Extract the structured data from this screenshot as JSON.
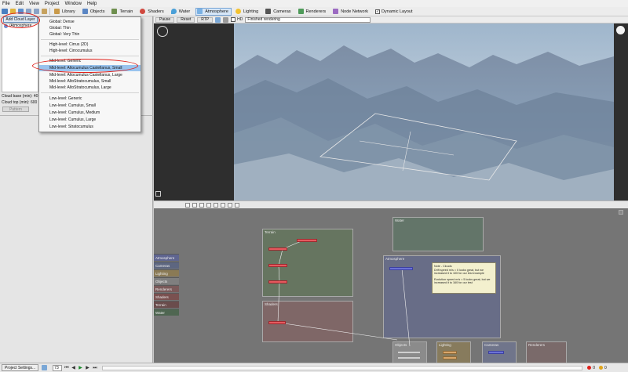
{
  "menubar": {
    "file": "File",
    "edit": "Edit",
    "view": "View",
    "project": "Project",
    "window": "Window",
    "help": "Help"
  },
  "toolbar": {
    "library": "Library",
    "objects": "Objects",
    "terrain": "Terrain",
    "shaders": "Shaders",
    "water": "Water",
    "atmosphere": "Atmosphere",
    "lighting": "Lighting",
    "cameras": "Cameras",
    "renderers": "Renderers",
    "node_network": "Node Network",
    "dynamic_layout": "Dynamic Layout"
  },
  "left_panel": {
    "add_cloud_layer": "Add Cloud Layer",
    "layer_item": "/Atmosphere",
    "cloud_base": "Cloud base (min): 40",
    "cloud_top": "Cloud top (min): 600",
    "pattern_button": "Pattern"
  },
  "dropdown": {
    "items": [
      "Global: Dense",
      "Global: Thin",
      "Global: Very Thin",
      "High-level: Cirrus (2D)",
      "High-level: Cirrocumulus",
      "Mid-level: Generic",
      "Mid-level: Altocumulus Castellanus, Small",
      "Mid-level: Altocumulus Castellanus, Large",
      "Mid-level: AltoStratocumulus, Small",
      "Mid-level: AltoStratocumulus, Large",
      "Low-level: Generic",
      "Low-level: Cumulus, Small",
      "Low-level: Cumulus, Medium",
      "Low-level: Cumulus, Large",
      "Low-level: Stratocumulus"
    ],
    "selected": "Mid-level: Altocumulus Castellanus, Small"
  },
  "viewport": {
    "pause": "Pause",
    "reset": "Reset",
    "rtp": "RTP",
    "hd": "HD",
    "status": "Finished rendering"
  },
  "node_editor": {
    "groups": {
      "terrain": "Terrain",
      "water": "Water",
      "atmosphere": "Atmosphere",
      "shaders": "Shaders",
      "objects": "Objects",
      "lighting": "Lighting",
      "cameras": "Cameras",
      "renderers": "Renderers"
    },
    "legend": [
      "Atmosphere",
      "Cameras",
      "Lighting",
      "Objects",
      "Renderers",
      "Shaders",
      "Terrain",
      "Water"
    ],
    "legend_colors": [
      "#5f6590",
      "#5d6680",
      "#8a7a55",
      "#7f7f7f",
      "#7b5a5a",
      "#7a5150",
      "#6a4c4c",
      "#4f6651"
    ],
    "note": {
      "title": "Note - Clouds",
      "line1": "Drift speed m/s = 0 looks great, but we increased it to 100 for our test example",
      "line2": "Evolution speed m/s = 5 looks great, but we increased it to 160 for our test"
    }
  },
  "statusbar": {
    "project_settings": "Project Settings...",
    "frame": "73",
    "errors": "0",
    "warnings": "0"
  }
}
